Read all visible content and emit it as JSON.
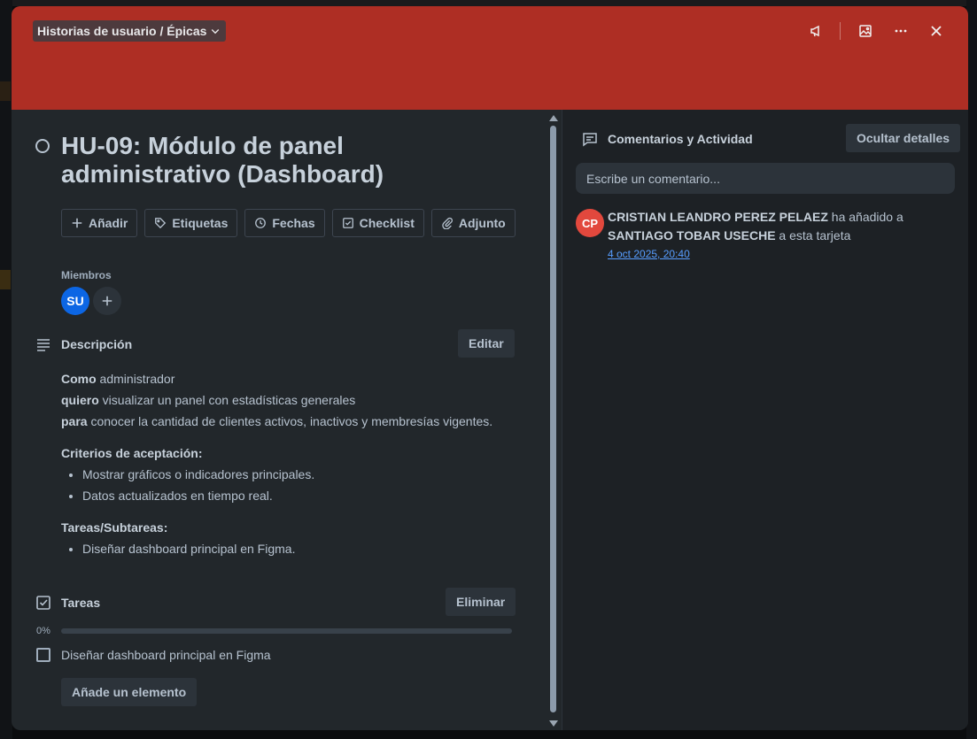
{
  "card": {
    "list_name": "Historias de usuario / Épicas",
    "title": "HU-09: Módulo de panel administrativo (Dashboard)",
    "cover_color": "#ae2e24"
  },
  "cover_actions": {
    "watch_icon": "megaphone-icon",
    "cover_icon": "image-icon",
    "more_icon": "ellipsis-icon",
    "close_icon": "close-icon"
  },
  "actions": [
    {
      "label": "Añadir",
      "icon": "plus-icon"
    },
    {
      "label": "Etiquetas",
      "icon": "tag-icon"
    },
    {
      "label": "Fechas",
      "icon": "clock-icon"
    },
    {
      "label": "Checklist",
      "icon": "checkbox-icon"
    },
    {
      "label": "Adjunto",
      "icon": "paperclip-icon"
    }
  ],
  "members": {
    "label": "Miembros",
    "avatars": [
      {
        "initials": "SU",
        "color": "#0c66e4"
      }
    ]
  },
  "description": {
    "title": "Descripción",
    "edit_label": "Editar",
    "line1_bold": "Como",
    "line1_rest": " administrador",
    "line2_bold": "quiero",
    "line2_rest": " visualizar un panel con estadísticas generales",
    "line3_bold": "para",
    "line3_rest": " conocer la cantidad de clientes activos, inactivos y membresías vigentes.",
    "criteria_title": "Criterios de aceptación:",
    "criteria": [
      "Mostrar gráficos o indicadores principales.",
      "Datos actualizados en tiempo real."
    ],
    "tasks_title": "Tareas/Subtareas:",
    "tasks": [
      "Diseñar dashboard principal en Figma."
    ]
  },
  "checklist": {
    "title": "Tareas",
    "delete_label": "Eliminar",
    "progress_label": "0%",
    "progress": 0,
    "items": [
      {
        "label": "Diseñar dashboard principal en Figma",
        "checked": false
      }
    ],
    "add_label": "Añade un elemento"
  },
  "activity": {
    "title": "Comentarios y Actividad",
    "hide_details_label": "Ocultar detalles",
    "comment_placeholder": "Escribe un comentario...",
    "entries": [
      {
        "initials": "CP",
        "actor": "CRISTIAN LEANDRO PEREZ PELAEZ",
        "verb": " ha añadido a ",
        "target": "SANTIAGO TOBAR USECHE",
        "suffix": " a esta tarjeta",
        "time": "4 oct 2025, 20:40"
      }
    ]
  }
}
